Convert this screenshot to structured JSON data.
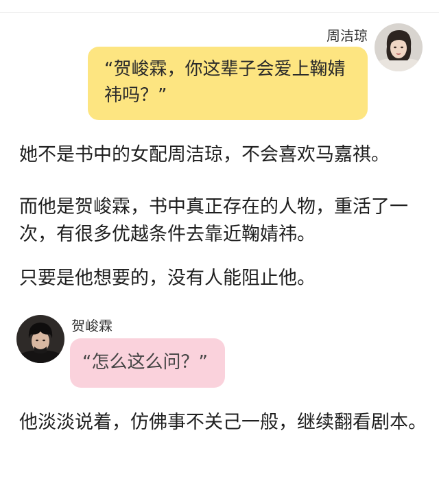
{
  "chat": {
    "messages": [
      {
        "sender": "周洁琼",
        "avatar_icon": "woman-portrait-avatar",
        "text": "“贺峻霖，你这辈子会爱上鞠婧祎吗？”",
        "bubble_color": "#fde581",
        "side": "right"
      },
      {
        "sender": "贺峻霖",
        "avatar_icon": "man-portrait-avatar",
        "text": "“怎么这么问？”",
        "bubble_color": "#fad2dc",
        "side": "left"
      }
    ]
  },
  "story": {
    "paragraphs": [
      "她不是书中的女配周洁琼，不会喜欢马嘉祺。",
      "而他是贺峻霖，书中真正存在的人物，重活了一次，有很多优越条件去靠近鞠婧祎。",
      "只要是他想要的，没有人能阻止他。",
      "他淡淡说着，仿佛事不关己一般，继续翻看剧本。"
    ]
  }
}
